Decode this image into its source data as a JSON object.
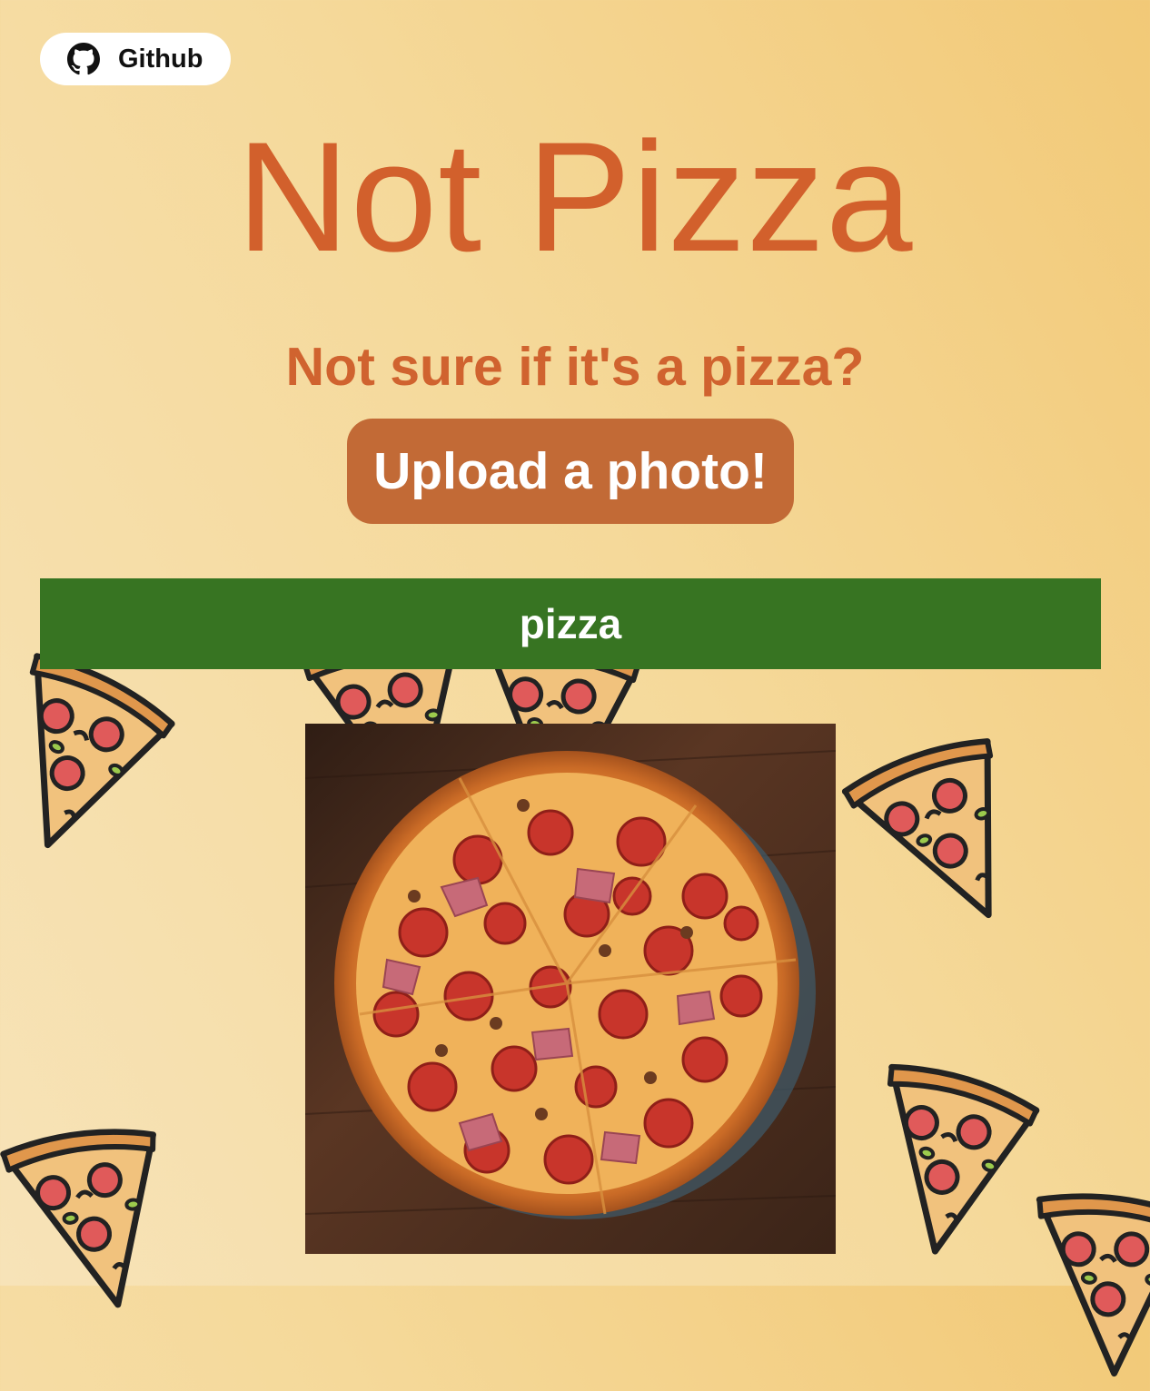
{
  "github": {
    "label": "Github",
    "icon": "github-icon"
  },
  "title": "Not Pizza",
  "subtitle": "Not sure if it's a pizza?",
  "upload": {
    "label": "Upload a photo!"
  },
  "result": {
    "label": "pizza",
    "color": "#377422"
  },
  "colors": {
    "accent": "#d2602c",
    "button": "#c26a36",
    "background_start": "#f7e3b8",
    "background_end": "#f2c977"
  }
}
